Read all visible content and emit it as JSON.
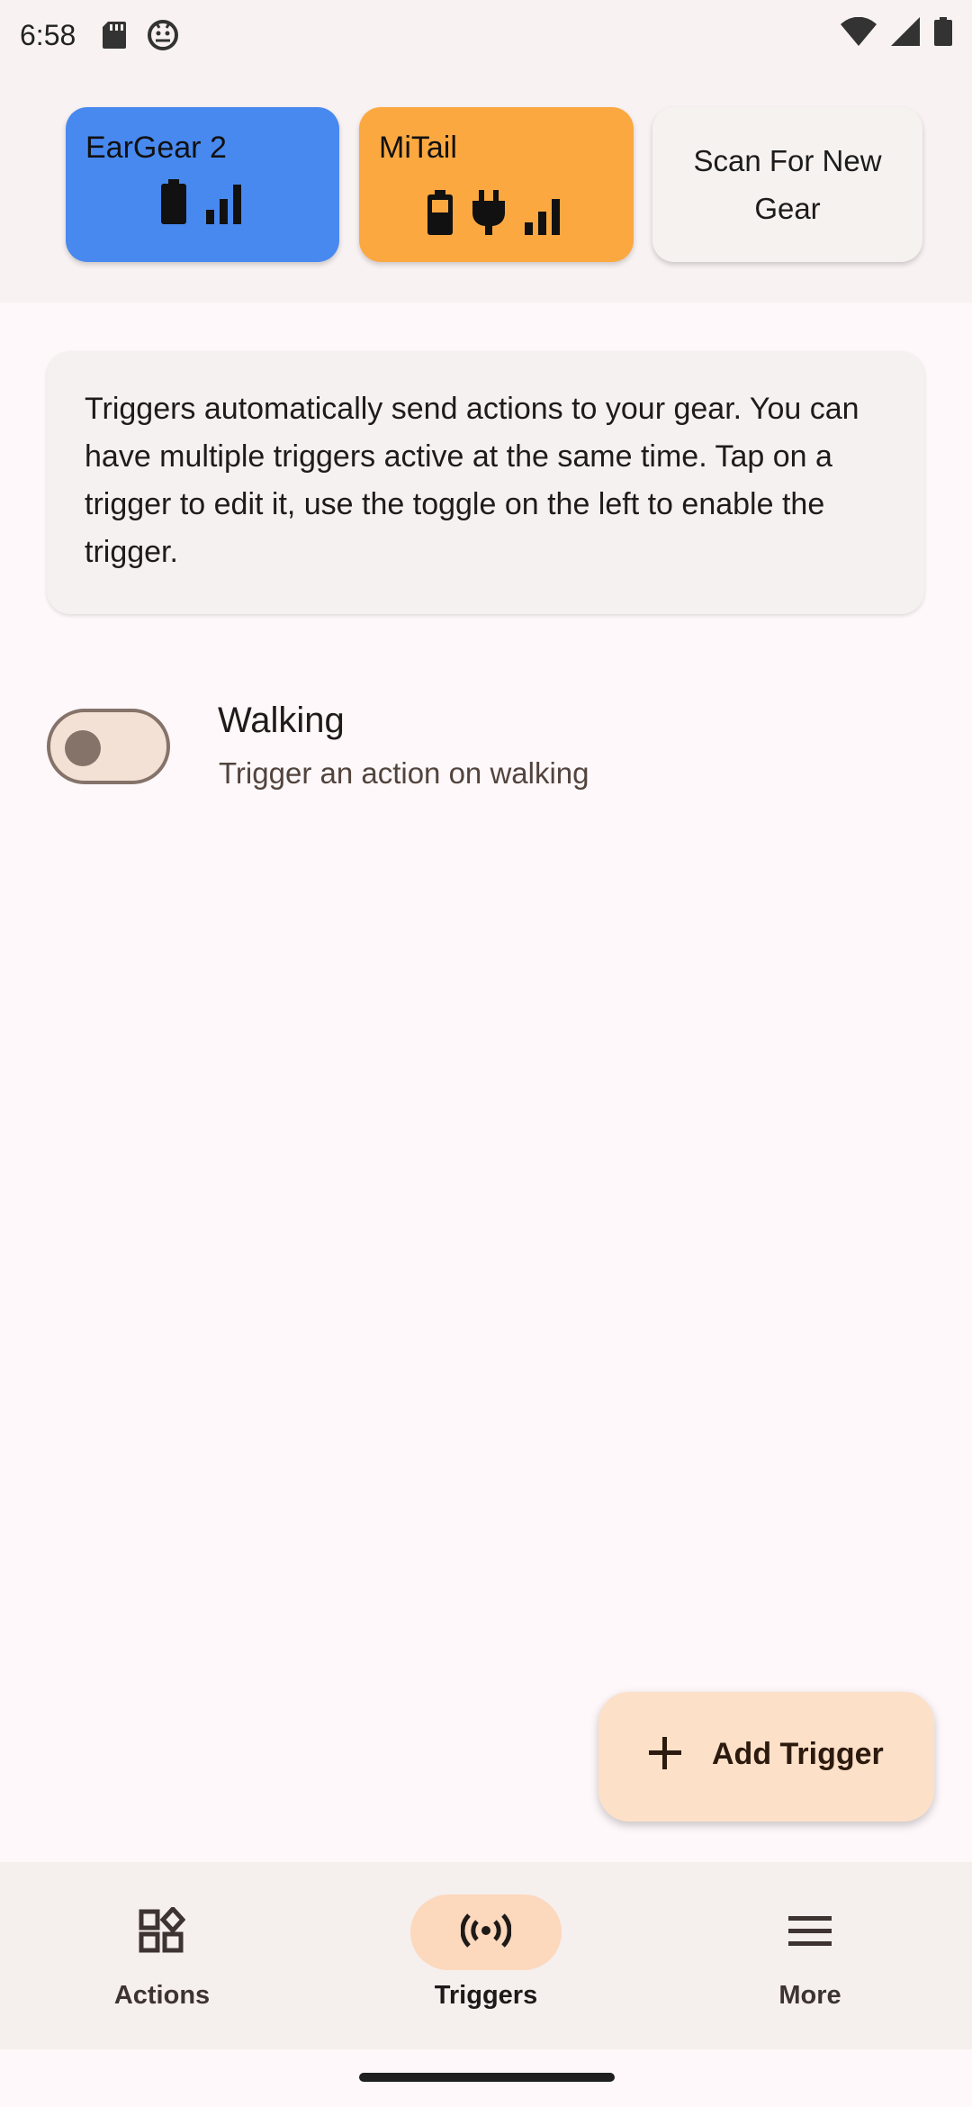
{
  "status_bar": {
    "time": "6:58",
    "icons": [
      "sd-card-icon",
      "android-debug-icon",
      "wifi-icon",
      "cell-signal-icon",
      "battery-icon"
    ]
  },
  "gear": [
    {
      "name": "EarGear 2",
      "color": "#4889f0",
      "icons": [
        "battery-icon",
        "signal-bars-icon"
      ]
    },
    {
      "name": "MiTail",
      "color": "#fba841",
      "icons": [
        "battery-icon",
        "plug-icon",
        "signal-bars-icon"
      ]
    }
  ],
  "scan_button": {
    "label": "Scan For New Gear"
  },
  "info": {
    "text": "Triggers automatically send actions to your gear. You can have multiple triggers active at the same time. Tap on a trigger to edit it, use the toggle on the left to enable the trigger."
  },
  "triggers": [
    {
      "title": "Walking",
      "subtitle": "Trigger an action on walking",
      "enabled": false
    }
  ],
  "fab": {
    "label": "Add Trigger",
    "icon": "plus-icon"
  },
  "nav": {
    "items": [
      {
        "label": "Actions",
        "icon": "actions-grid-icon",
        "active": false
      },
      {
        "label": "Triggers",
        "icon": "broadcast-icon",
        "active": true
      },
      {
        "label": "More",
        "icon": "menu-icon",
        "active": false
      }
    ]
  },
  "colors": {
    "accent": "#fba841",
    "toggle_track": "#f4e1d5",
    "fab_bg": "#fde0c8"
  }
}
